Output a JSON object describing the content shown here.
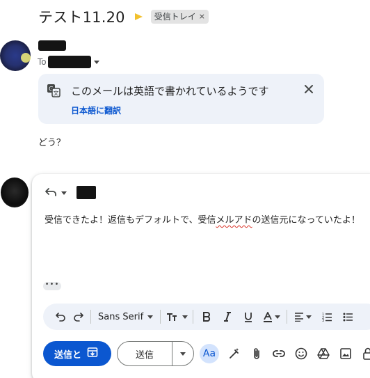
{
  "message": {
    "subject": "テスト11.20",
    "label": "受信トレイ",
    "label_remove": "×",
    "to_prefix": "To",
    "body": "どう？"
  },
  "translate_banner": {
    "message": "このメールは英語で書かれているようです",
    "action": "日本語に翻訳"
  },
  "compose": {
    "text_before": "受信できたよ！返信もデフォルトで、受信",
    "text_misspelled": "メルアド",
    "text_after": "の送信元になっていたよ！",
    "ellipsis": "•••",
    "font": "Sans Serif",
    "send_later_label": "送信と",
    "send_label": "送信",
    "text_format_label": "Aa"
  },
  "colors": {
    "accent": "#0b57d0",
    "importance": "#f2c12e",
    "banner_bg": "#eef2f9",
    "label_bg": "#e3e3e3"
  },
  "icons": {
    "importance": "importance-marker-icon",
    "translate": "translate-icon",
    "close": "close-icon",
    "reply": "reply-icon",
    "undo": "undo-icon",
    "redo": "redo-icon",
    "text-size": "text-size-icon",
    "bold": "bold-icon",
    "italic": "italic-icon",
    "underline": "underline-icon",
    "text-color": "text-color-icon",
    "align": "align-icon",
    "numbered-list": "numbered-list-icon",
    "bulleted-list": "bulleted-list-icon",
    "archive": "archive-icon",
    "magic-pen": "magic-pen-icon",
    "attach": "paperclip-icon",
    "link": "link-icon",
    "emoji": "emoji-icon",
    "drive": "drive-icon",
    "photo": "photo-icon",
    "lock": "lock-icon"
  }
}
